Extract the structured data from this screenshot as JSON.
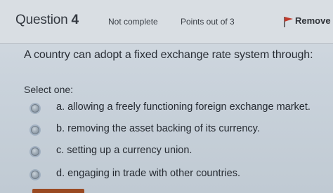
{
  "header": {
    "question_word": "Question",
    "question_number": "4",
    "status": "Not complete",
    "points": "Points out of 3",
    "remove_label": "Remove f"
  },
  "question": {
    "text": "A country can adopt a fixed exchange rate system through:"
  },
  "prompt": "Select one:",
  "options": [
    {
      "label": "a. allowing a freely functioning foreign exchange market."
    },
    {
      "label": "b. removing the asset backing of its currency."
    },
    {
      "label": "c. setting up a currency union."
    },
    {
      "label": "d. engaging in trade with other countries."
    }
  ],
  "colors": {
    "flag": "#c0392b",
    "button": "#9a4a22"
  },
  "icons": {
    "flag": "flag-icon"
  }
}
